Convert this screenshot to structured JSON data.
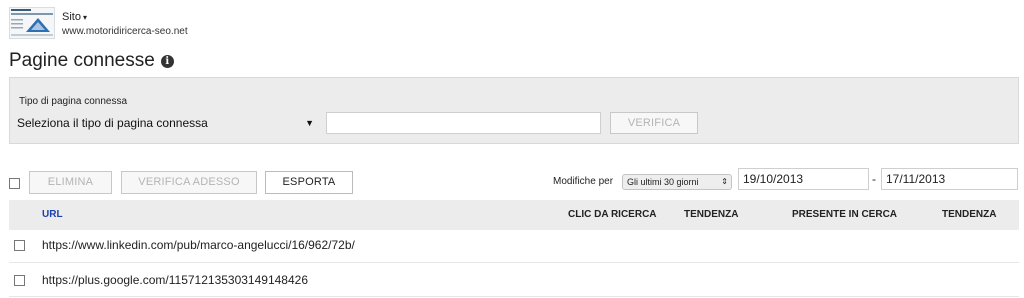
{
  "site": {
    "label": "Sito",
    "caret": "▾",
    "url": "www.motoridiricerca-seo.net"
  },
  "page": {
    "title": "Pagine connesse",
    "info_icon": "i"
  },
  "filter": {
    "label": "Tipo di pagina connessa",
    "select_value": "Seleziona il tipo di pagina connessa",
    "select_arrow": "▼",
    "url_value": "",
    "verify_label": "VERIFICA"
  },
  "toolbar": {
    "delete_label": "ELIMINA",
    "check_now_label": "VERIFICA ADESSO",
    "export_label": "ESPORTA",
    "changes_label": "Modifiche per",
    "period_value": "Gli ultimi 30 giorni",
    "period_arrows": "⇕",
    "date_from": "19/10/2013",
    "date_separator": "-",
    "date_to": "17/11/2013"
  },
  "table": {
    "columns": {
      "url": "URL",
      "clicks": "CLIC DA RICERCA",
      "trend1": "TENDENZA",
      "in_search": "PRESENTE IN CERCA",
      "trend2": "TENDENZA"
    },
    "rows": [
      {
        "url": "https://www.linkedin.com/pub/marco-angelucci/16/962/72b/"
      },
      {
        "url": "https://plus.google.com/115712135303149148426"
      }
    ]
  }
}
